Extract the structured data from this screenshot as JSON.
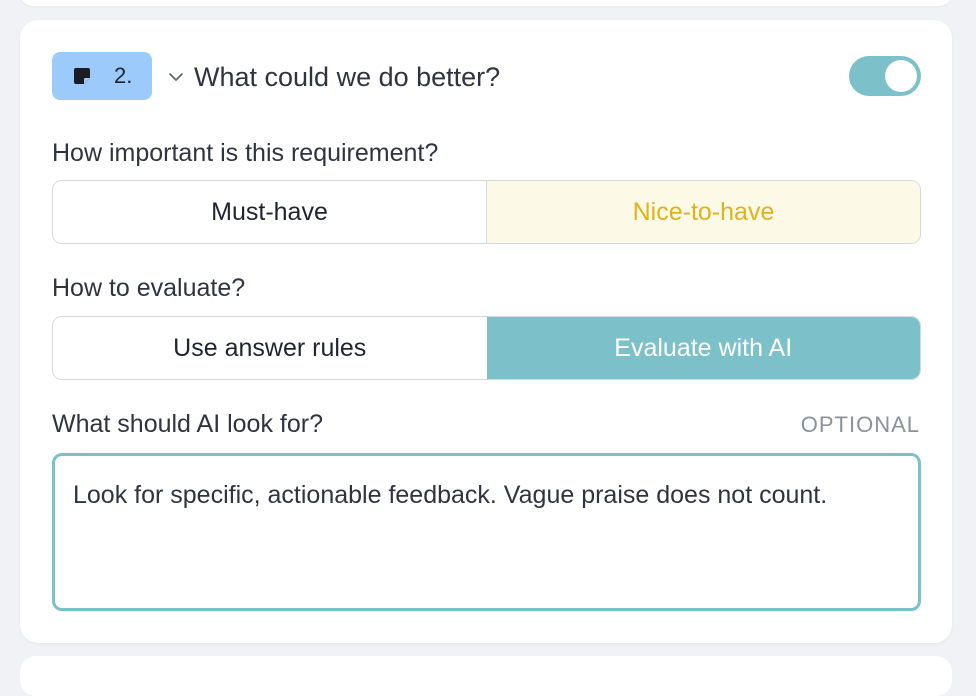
{
  "question": {
    "number": "2.",
    "title": "What could we do better?",
    "enabled": true,
    "icon": "sticky-note-icon"
  },
  "importance": {
    "label": "How important is this requirement?",
    "options": [
      "Must-have",
      "Nice-to-have"
    ],
    "selected": "Nice-to-have"
  },
  "evaluation": {
    "label": "How to evaluate?",
    "options": [
      "Use answer rules",
      "Evaluate with AI"
    ],
    "selected": "Evaluate with AI"
  },
  "ai_prompt": {
    "label": "What should AI look for?",
    "optional_tag": "OPTIONAL",
    "value": "Look for specific, actionable feedback. Vague praise does not count."
  },
  "colors": {
    "accent": "#7cc0c9",
    "badge": "#9ccbfb",
    "nice_to_have_bg": "#fdf9e7",
    "nice_to_have_text": "#e0b21c"
  }
}
